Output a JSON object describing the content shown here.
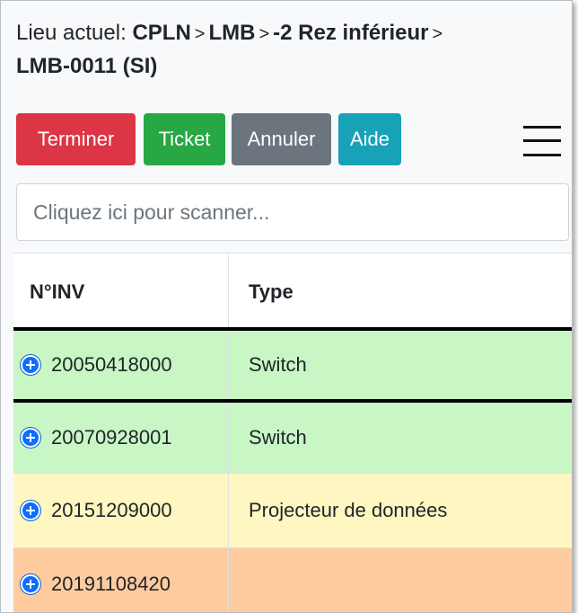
{
  "location": {
    "prefix": "Lieu actuel:",
    "parts": [
      "CPLN",
      "LMB",
      "-2 Rez inférieur",
      "LMB-0011 (SI)"
    ],
    "separator": ">"
  },
  "toolbar": {
    "terminer_label": "Terminer",
    "ticket_label": "Ticket",
    "annuler_label": "Annuler",
    "aide_label": "Aide",
    "colors": {
      "terminer": "#dc3545",
      "ticket": "#28a745",
      "annuler": "#6c757d",
      "aide": "#17a2b8"
    }
  },
  "scan": {
    "placeholder": "Cliquez ici pour scanner...",
    "value": ""
  },
  "table": {
    "columns": [
      "N°INV",
      "Type"
    ],
    "rows": [
      {
        "inv": "20050418000",
        "type": "Switch",
        "color": "#c8f7c5"
      },
      {
        "inv": "20070928001",
        "type": "Switch",
        "color": "#c8f7c5"
      },
      {
        "inv": "20151209000",
        "type": "Projecteur de données",
        "color": "#fff7c2"
      },
      {
        "inv": "20191108420",
        "type": "",
        "color": "#fecb9f"
      }
    ]
  }
}
